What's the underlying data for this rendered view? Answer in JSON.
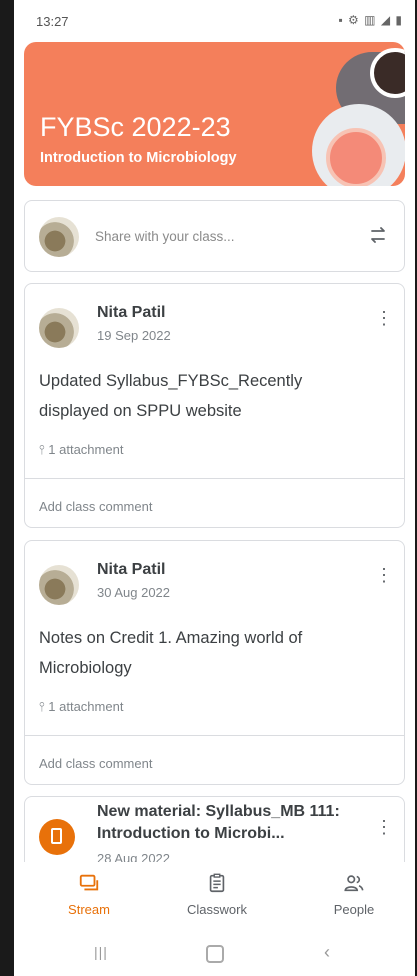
{
  "statusbar": {
    "time": "13:27",
    "icons": "▪ ⚙ ▥ ◢ ▮"
  },
  "class": {
    "title": "FYBSc 2022-23",
    "subtitle": "Introduction to Microbiology"
  },
  "share": {
    "placeholder": "Share with your class..."
  },
  "posts": [
    {
      "author": "Nita Patil",
      "date": "19 Sep 2022",
      "text": "Updated Syllabus_FYBSc_Recently displayed on SPPU website",
      "attachments": "1 attachment",
      "comment_placeholder": "Add class comment"
    },
    {
      "author": "Nita Patil",
      "date": "30 Aug 2022",
      "text": "Notes on Credit 1. Amazing world of Microbiology",
      "attachments": "1 attachment",
      "comment_placeholder": "Add class comment"
    },
    {
      "title": "New material: Syllabus_MB 111: Introduction to Microbi...",
      "date": "28 Aug 2022"
    }
  ],
  "nav": {
    "stream": "Stream",
    "classwork": "Classwork",
    "people": "People",
    "active_color": "#e8710a"
  },
  "colors": {
    "banner": "#f47f5b",
    "accent": "#e8710a"
  }
}
